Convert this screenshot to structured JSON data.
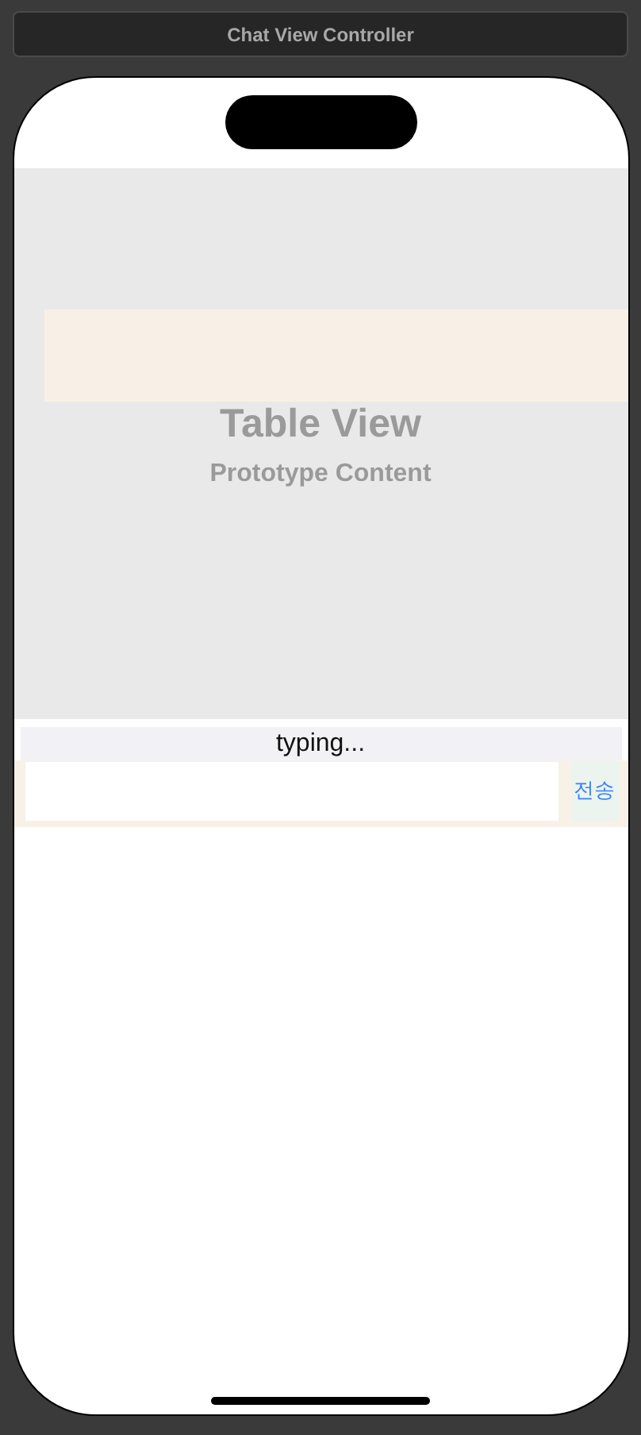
{
  "scene_title": "Chat View Controller",
  "table_view": {
    "title": "Table View",
    "subtitle": "Prototype Content"
  },
  "typing_label": "typing...",
  "send_button": {
    "label": "전송"
  }
}
